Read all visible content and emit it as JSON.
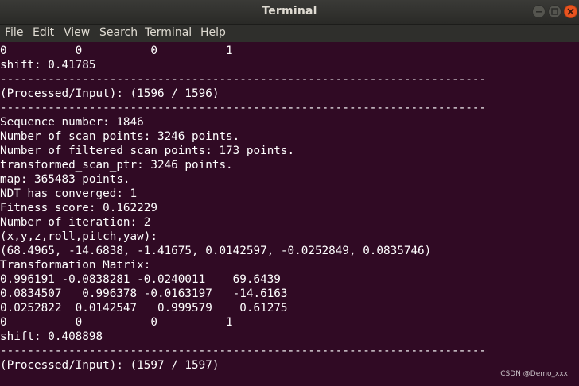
{
  "window": {
    "title": "Terminal"
  },
  "menu": [
    {
      "id": "file",
      "label": "File"
    },
    {
      "id": "edit",
      "label": "Edit"
    },
    {
      "id": "view",
      "label": "View"
    },
    {
      "id": "search",
      "label": "Search"
    },
    {
      "id": "terminal",
      "label": "Terminal"
    },
    {
      "id": "help",
      "label": "Help"
    }
  ],
  "terminal": {
    "lines": [
      "0          0          0          1",
      "shift: 0.41785",
      "-----------------------------------------------------------------------",
      "(Processed/Input): (1596 / 1596)",
      "-----------------------------------------------------------------------",
      "Sequence number: 1846",
      "Number of scan points: 3246 points.",
      "Number of filtered scan points: 173 points.",
      "transformed_scan_ptr: 3246 points.",
      "map: 365483 points.",
      "NDT has converged: 1",
      "Fitness score: 0.162229",
      "Number of iteration: 2",
      "(x,y,z,roll,pitch,yaw):",
      "(68.4965, -14.6838, -1.41675, 0.0142597, -0.0252849, 0.0835746)",
      "Transformation Matrix:",
      "0.996191 -0.0838281 -0.0240011    69.6439",
      "0.0834507   0.996378 -0.0163197   -14.6163",
      "0.0252822  0.0142547   0.999579    0.61275",
      "0          0          0          1",
      "shift: 0.408898",
      "-----------------------------------------------------------------------",
      "(Processed/Input): (1597 / 1597)"
    ]
  },
  "watermark": "CSDN @Demo_xxx",
  "colors": {
    "terminal_bg": "#300a24",
    "titlebar_bg": "#2f2f2c",
    "close_button": "#e95420",
    "text": "#ffffff"
  },
  "icons": {
    "minimize": "minimize-icon",
    "maximize": "maximize-icon",
    "close": "close-icon"
  }
}
